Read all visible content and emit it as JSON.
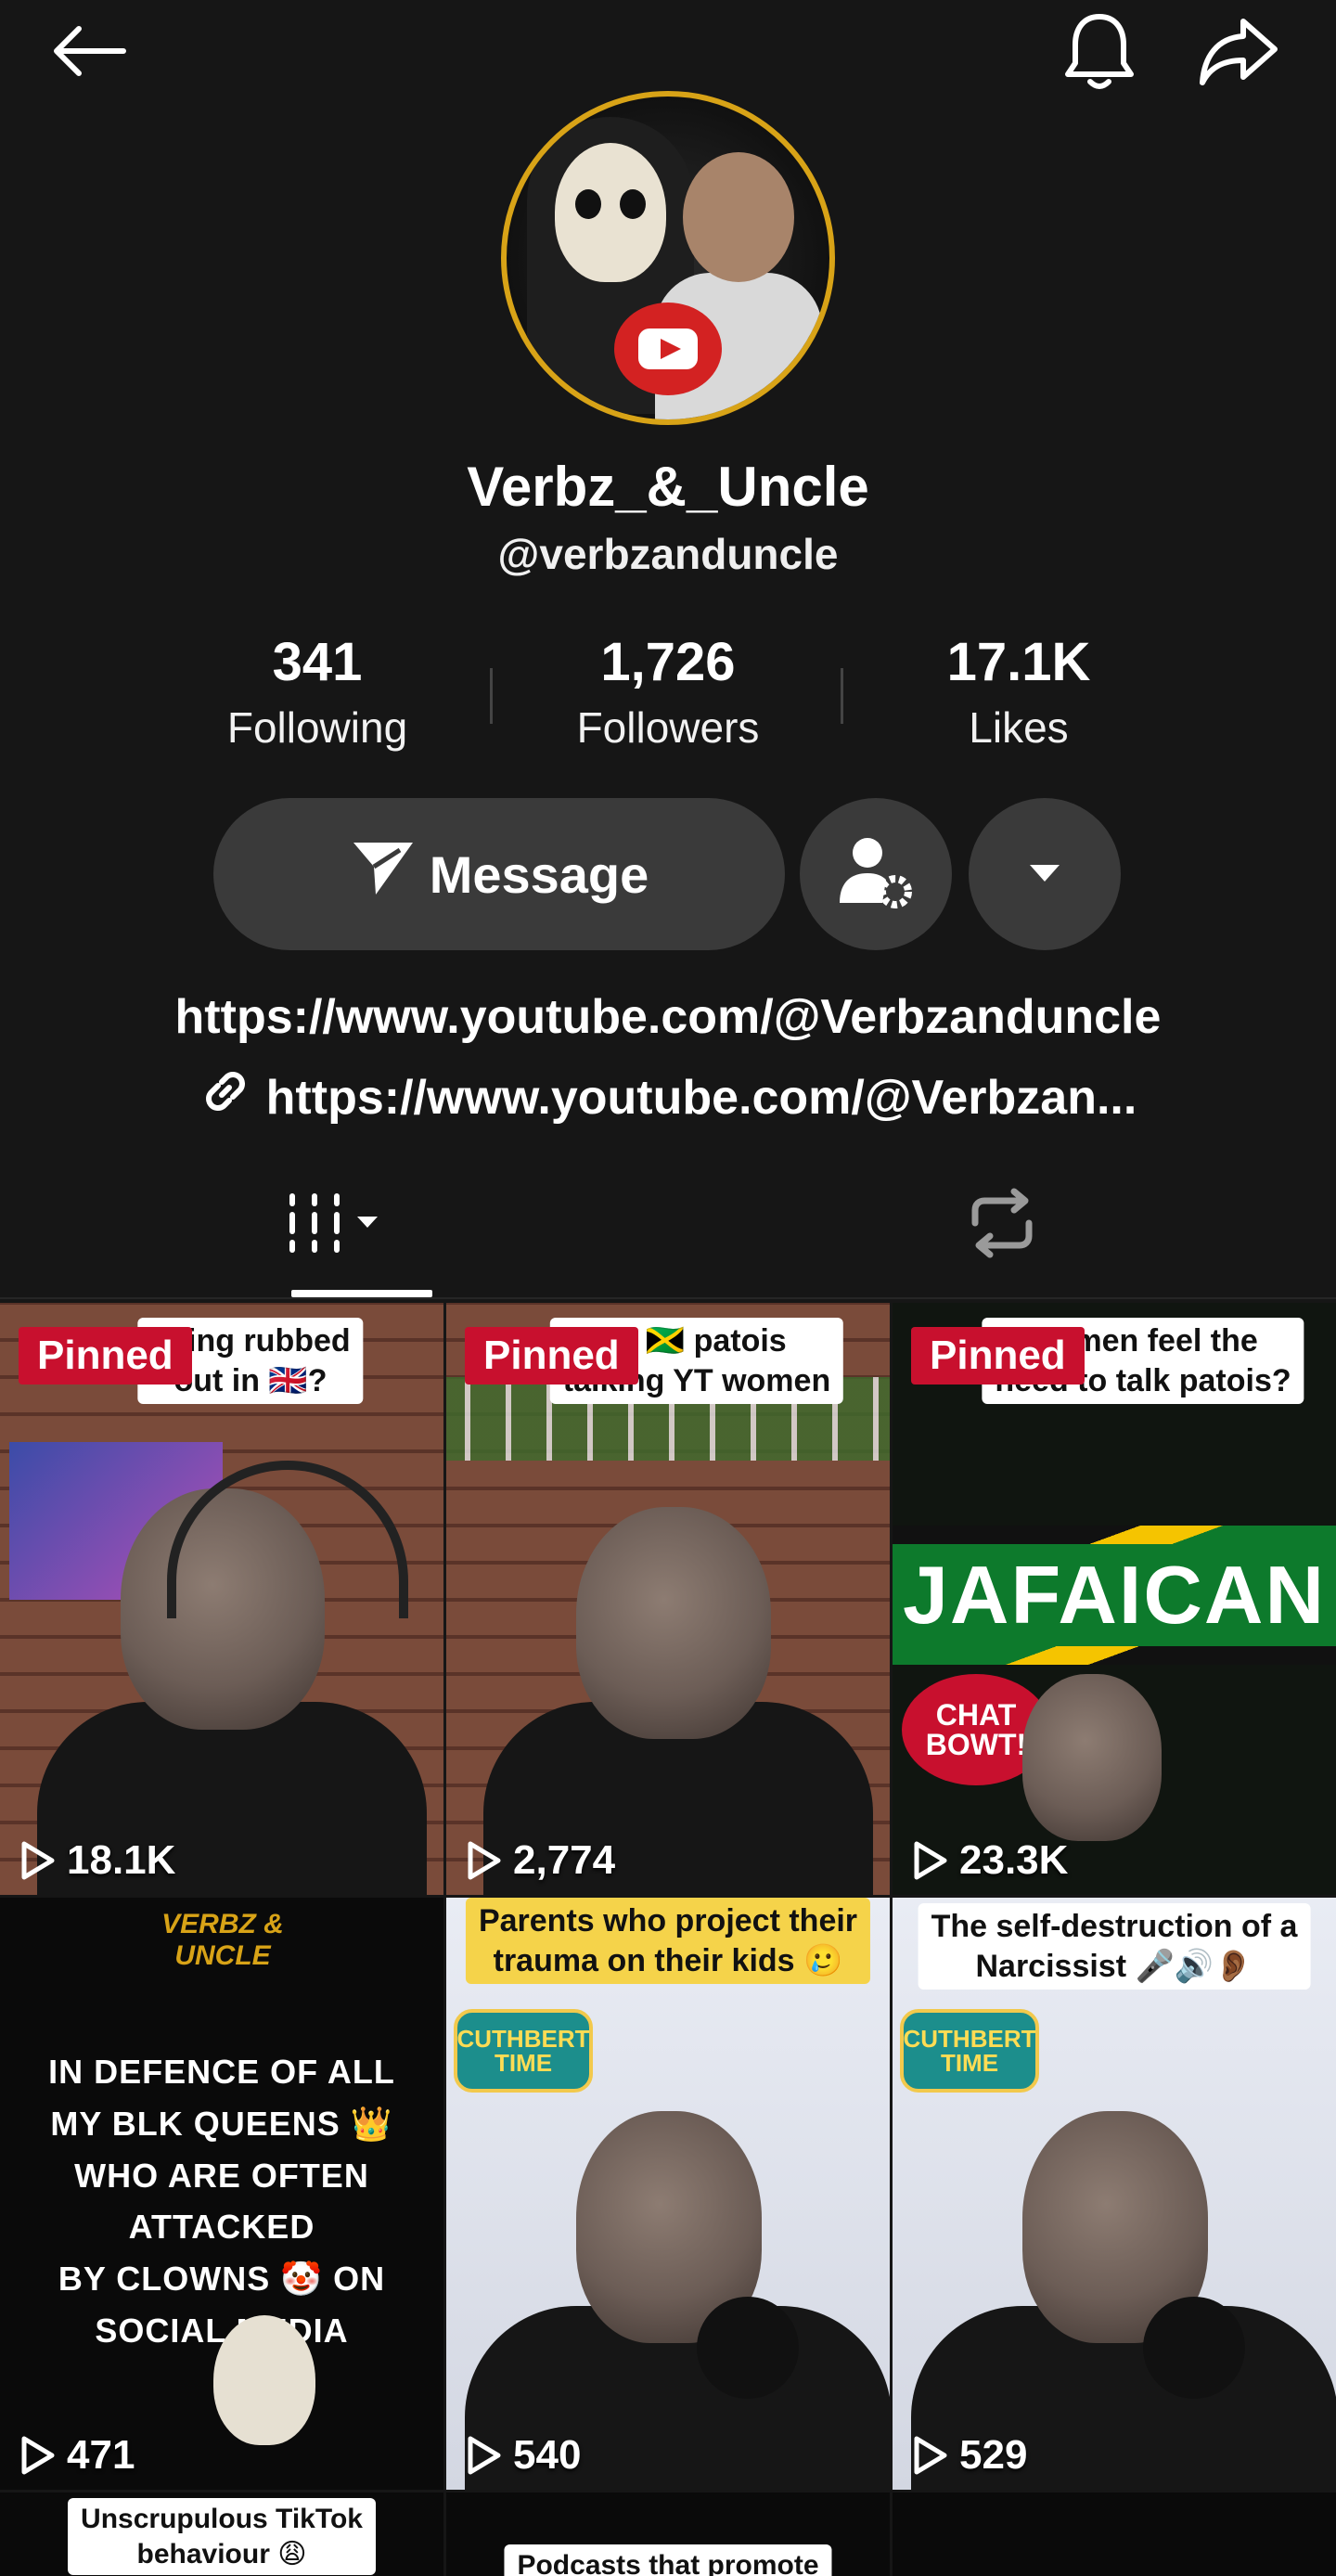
{
  "profile": {
    "display_name": "Verbz_&_Uncle",
    "handle": "@verbzanduncle",
    "following_count": "341",
    "following_label": "Following",
    "followers_count": "1,726",
    "followers_label": "Followers",
    "likes_count": "17.1K",
    "likes_label": "Likes"
  },
  "actions": {
    "message_label": "Message"
  },
  "bio": {
    "line": "https://www.youtube.com/@Verbzanduncle",
    "link": "https://www.youtube.com/@Verbzan..."
  },
  "icons": {
    "back": "back-arrow-icon",
    "bell": "bell-icon",
    "share": "share-icon",
    "message": "send-icon",
    "friend_settings": "user-settings-icon",
    "more": "caret-down-icon",
    "link": "link-icon",
    "videos_tab": "grid-icon",
    "reposts_tab": "repost-icon",
    "play": "play-icon"
  },
  "colors": {
    "background": "#161616",
    "button": "#3a3a3a",
    "pinned_badge": "#c8102e",
    "avatar_ring": "#d8a317"
  },
  "videos": [
    {
      "pinned": "Pinned",
      "caption_1": "being rubbed",
      "caption_2": "out in 🇬🇧?",
      "views": "18.1K"
    },
    {
      "pinned": "Pinned",
      "caption_1": "th 🇯🇲 patois",
      "caption_2": "talking YT women",
      "views": "2,774"
    },
    {
      "pinned": "Pinned",
      "caption_1": "an men feel the",
      "caption_2": "need to talk patois?",
      "views": "23.3K",
      "overlay": "JAFAICAN",
      "badge": "CHAT BOWT!"
    },
    {
      "caption_1": "IN DEFENCE OF ALL",
      "caption_2": "MY BLK QUEENS 👑",
      "caption_3": "WHO ARE OFTEN ATTACKED",
      "caption_4": "BY CLOWNS 🤡 ON",
      "caption_5": "SOCIAL MEDIA",
      "brand": "VERBZ & UNCLE",
      "views": "471"
    },
    {
      "caption_1": "Parents who project their",
      "caption_2": "trauma on their kids 🥲",
      "logo": "CUTHBERT TIME",
      "views": "540"
    },
    {
      "caption_1": "The self-destruction of a",
      "caption_2": "Narcissist 🎤🔊👂🏾",
      "logo": "CUTHBERT TIME",
      "views": "529"
    },
    {
      "caption_1": "Unscrupulous TikTok",
      "caption_2": "behaviour 😩"
    },
    {
      "caption_1": "Podcasts that promote"
    },
    {}
  ]
}
